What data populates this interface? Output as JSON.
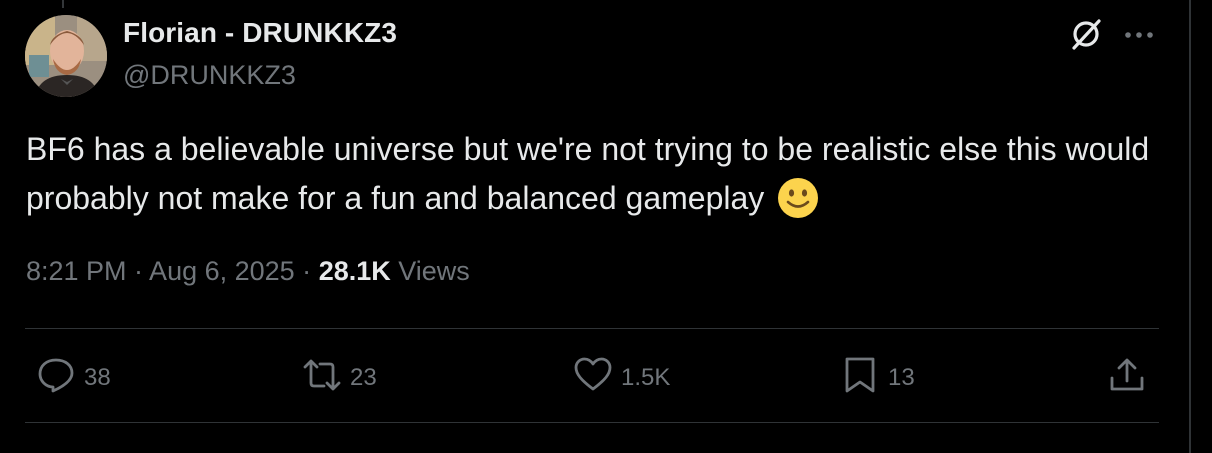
{
  "tweet": {
    "author": {
      "display_name": "Florian - DRUNKKZ3",
      "handle": "@DRUNKKZ3"
    },
    "text": "BF6 has a believable universe but we're not trying to be realistic else this would probably not make for a fun and balanced gameplay",
    "emoji": "slightly-smiling-face",
    "timestamp": "8:21 PM · Aug 6, 2025 · ",
    "views_count": "28.1K",
    "views_label": " Views"
  },
  "actions": {
    "replies": "38",
    "reposts": "23",
    "likes": "1.5K",
    "bookmarks": "13"
  },
  "colors": {
    "background": "#000000",
    "text": "#e7e9ea",
    "muted": "#71767b",
    "divider": "#2f3336"
  },
  "icons": [
    "grok-icon",
    "more-icon",
    "reply-icon",
    "repost-icon",
    "like-icon",
    "bookmark-icon",
    "share-icon"
  ]
}
